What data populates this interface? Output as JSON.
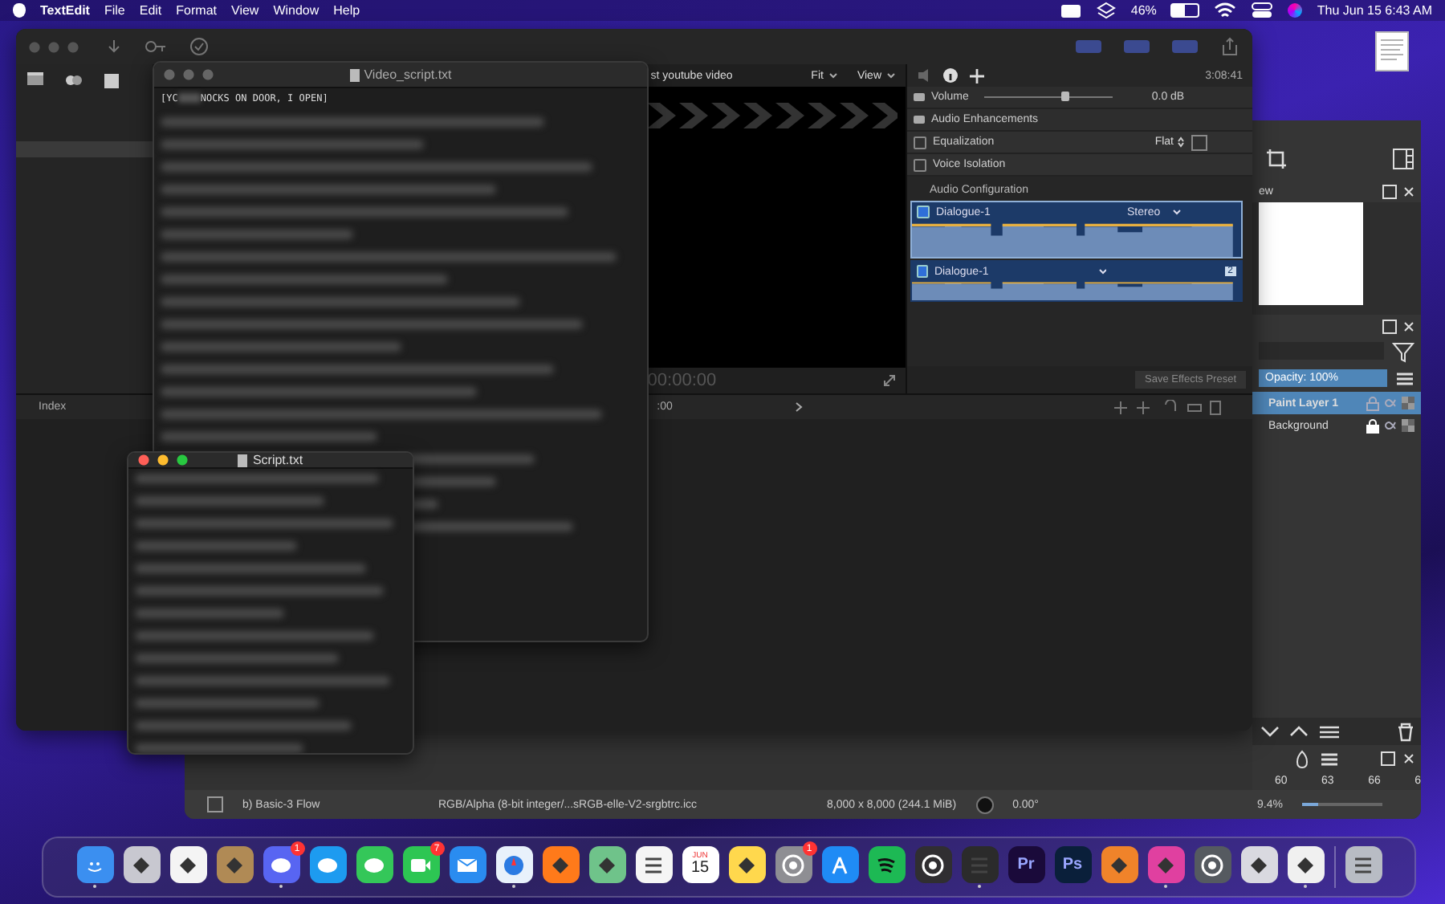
{
  "menu_bar": {
    "app_name": "TextEdit",
    "menus": [
      "File",
      "Edit",
      "Format",
      "View",
      "Window",
      "Help"
    ],
    "battery": {
      "reading": "46%",
      "level": 0.46
    },
    "clock": "Thu Jun 15  6:43 AM"
  },
  "video_editor": {
    "viewer_title": "st youtube video",
    "viewer_menus": [
      "Fit",
      "View"
    ],
    "timecode": "3:08:41",
    "viewer_timecode": "00:00:00",
    "volume": {
      "label": "Volume",
      "level": 0.62,
      "reading": "0.0 dB"
    },
    "enhancements_title": "Audio Enhancements",
    "enhancements": [
      {
        "label": "Equalization",
        "checked": false,
        "value": "Flat"
      },
      {
        "label": "Voice Isolation",
        "checked": false
      }
    ],
    "config_title": "Audio Configuration",
    "channels": [
      {
        "name": "Dialogue-1",
        "checked": true,
        "selected": true,
        "mode": "Stereo"
      },
      {
        "name": "Dialogue-1",
        "checked": true,
        "selected": false,
        "mode": "2"
      }
    ],
    "save_preset": "Save Effects Preset",
    "index_tab": "Index",
    "timeline_time": ":00"
  },
  "video_script_window": {
    "title": "Video_script.txt",
    "first_line_start": "[YC",
    "first_line_end": "NOCKS ON DOOR, I OPEN]"
  },
  "script_window": {
    "title": "Script.txt"
  },
  "paint_app": {
    "overview_label": "ew",
    "opacity": {
      "text": "Opacity:  100%",
      "level": 1
    },
    "zoom_slider": {
      "level": 0.2
    },
    "layers": [
      {
        "name": "Paint Layer 1",
        "selected": true,
        "locked": false
      },
      {
        "name": "Background",
        "selected": false,
        "locked": true
      }
    ],
    "ruler": [
      "60",
      "63",
      "66",
      "6"
    ],
    "status": {
      "brush": "b) Basic-3 Flow",
      "color_space": "RGB/Alpha (8-bit integer/...sRGB-elle-V2-srgbtrc.icc",
      "size": "8,000 x 8,000 (244.1 MiB)",
      "rotation": "0.00°",
      "zoom": "9.4%"
    }
  },
  "dock": [
    {
      "kind": "finder",
      "color": "#3b8ff0",
      "running": true
    },
    {
      "kind": "grid",
      "color": "#c8c8d0",
      "running": false
    },
    {
      "kind": "flower",
      "color": "#f4f4f4",
      "running": false
    },
    {
      "kind": "book",
      "color": "#b08a55",
      "running": false
    },
    {
      "kind": "chat",
      "color": "#5865f2",
      "running": true,
      "badge": "1"
    },
    {
      "kind": "bird",
      "color": "#1d9bf0",
      "running": false
    },
    {
      "kind": "bubble",
      "color": "#34c759",
      "running": false
    },
    {
      "kind": "camera",
      "color": "#2dc653",
      "running": false,
      "badge": "7"
    },
    {
      "kind": "mail",
      "color": "#2a8cf0",
      "running": false
    },
    {
      "kind": "compass",
      "color": "#e8f1fb",
      "running": true
    },
    {
      "kind": "fox",
      "color": "#ff7a1a",
      "running": false
    },
    {
      "kind": "map",
      "color": "#6fc38a",
      "running": false
    },
    {
      "kind": "list",
      "color": "#f5f5f5",
      "running": false
    },
    {
      "kind": "calendar",
      "color": "#ffffff",
      "running": false,
      "month": "JUN",
      "day": "15"
    },
    {
      "kind": "note",
      "color": "#ffd84d",
      "running": false
    },
    {
      "kind": "gear",
      "color": "#8e8e93",
      "running": false,
      "badge": "1"
    },
    {
      "kind": "store",
      "color": "#1f8bf5",
      "running": false
    },
    {
      "kind": "waves",
      "color": "#1db954",
      "running": false
    },
    {
      "kind": "record",
      "color": "#302e31",
      "running": false
    },
    {
      "kind": "clapper",
      "color": "#2b2b2b",
      "running": true
    },
    {
      "kind": "letters",
      "color": "#1a0a3a",
      "running": false,
      "text": "Pr"
    },
    {
      "kind": "letters",
      "color": "#0a1f3a",
      "running": false,
      "text": "Ps"
    },
    {
      "kind": "blend",
      "color": "#f0832a",
      "running": false
    },
    {
      "kind": "brush",
      "color": "#e040a0",
      "running": true
    },
    {
      "kind": "record",
      "color": "#555a60",
      "running": false
    },
    {
      "kind": "cube",
      "color": "#d9d9e0",
      "running": false
    },
    {
      "kind": "pen",
      "color": "#f0f0f0",
      "running": true
    },
    {
      "kind": "trash",
      "color": "#b8bcc4",
      "running": false
    }
  ]
}
